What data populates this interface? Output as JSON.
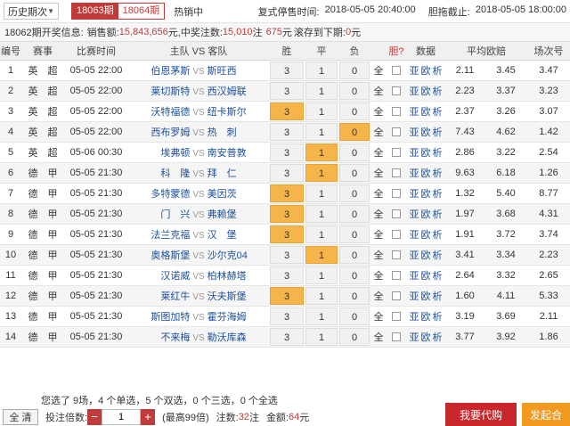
{
  "topbar": {
    "history_label": "历史期次",
    "tab_active": "18063期",
    "tab_inactive": "18064期",
    "sale_status": "热销中",
    "stop_time_label": "复式停售时间:",
    "stop_time": "2018-05-05 20:40:00",
    "deadline_label": "胆拖截止:",
    "deadline": "2018-05-05 18:00:00"
  },
  "infobar": {
    "prefix": "18062期开奖信息:",
    "sales_label": "销售额:",
    "sales": "15,843,656",
    "sales_unit": "元,",
    "prize_label": "中奖注数:",
    "prize_count": "15,010",
    "prize_unit": "注",
    "prize_amount": "675",
    "prize_amount_unit": "元",
    "rollover_label": "滚存到下期:",
    "rollover": "0",
    "rollover_unit": "元"
  },
  "headers": [
    "编号",
    "赛事",
    "比赛时间",
    "主队 VS 客队",
    "胜",
    "平",
    "负",
    "",
    "胆?",
    "数据",
    "平均欧赔",
    "场次号"
  ],
  "vs": "VS",
  "all_label": "全",
  "links": [
    "亚",
    "欧",
    "析"
  ],
  "rows": [
    {
      "no": "1",
      "league": "英　超",
      "time": "05-05 22:00",
      "home": "伯恩茅斯",
      "away": "斯旺西",
      "odds": [
        "3",
        "1",
        "0"
      ],
      "sel": [
        false,
        false,
        false
      ],
      "avg": [
        "2.11",
        "3.45",
        "3.47"
      ]
    },
    {
      "no": "2",
      "league": "英　超",
      "time": "05-05 22:00",
      "home": "莱切斯特",
      "away": "西汉姆联",
      "odds": [
        "3",
        "1",
        "0"
      ],
      "sel": [
        false,
        false,
        false
      ],
      "avg": [
        "2.23",
        "3.37",
        "3.23"
      ]
    },
    {
      "no": "3",
      "league": "英　超",
      "time": "05-05 22:00",
      "home": "沃特福德",
      "away": "纽卡斯尔",
      "odds": [
        "3",
        "1",
        "0"
      ],
      "sel": [
        true,
        false,
        false
      ],
      "avg": [
        "2.37",
        "3.26",
        "3.07"
      ]
    },
    {
      "no": "4",
      "league": "英　超",
      "time": "05-05 22:00",
      "home": "西布罗姆",
      "away": "热　刺",
      "odds": [
        "3",
        "1",
        "0"
      ],
      "sel": [
        false,
        false,
        true
      ],
      "avg": [
        "7.43",
        "4.62",
        "1.42"
      ]
    },
    {
      "no": "5",
      "league": "英　超",
      "time": "05-06 00:30",
      "home": "埃弗顿",
      "away": "南安普敦",
      "odds": [
        "3",
        "1",
        "0"
      ],
      "sel": [
        false,
        true,
        false
      ],
      "avg": [
        "2.86",
        "3.22",
        "2.54"
      ]
    },
    {
      "no": "6",
      "league": "德　甲",
      "time": "05-05 21:30",
      "home": "科　隆",
      "away": "拜　仁",
      "odds": [
        "3",
        "1",
        "0"
      ],
      "sel": [
        false,
        true,
        false
      ],
      "avg": [
        "9.63",
        "6.18",
        "1.26"
      ]
    },
    {
      "no": "7",
      "league": "德　甲",
      "time": "05-05 21:30",
      "home": "多特蒙德",
      "away": "美因茨",
      "odds": [
        "3",
        "1",
        "0"
      ],
      "sel": [
        true,
        false,
        false
      ],
      "avg": [
        "1.32",
        "5.40",
        "8.77"
      ]
    },
    {
      "no": "8",
      "league": "德　甲",
      "time": "05-05 21:30",
      "home": "门　兴",
      "away": "弗赖堡",
      "odds": [
        "3",
        "1",
        "0"
      ],
      "sel": [
        true,
        false,
        false
      ],
      "avg": [
        "1.97",
        "3.68",
        "4.31"
      ]
    },
    {
      "no": "9",
      "league": "德　甲",
      "time": "05-05 21:30",
      "home": "法兰克福",
      "away": "汉　堡",
      "odds": [
        "3",
        "1",
        "0"
      ],
      "sel": [
        true,
        false,
        false
      ],
      "avg": [
        "1.91",
        "3.72",
        "3.74"
      ]
    },
    {
      "no": "10",
      "league": "德　甲",
      "time": "05-05 21:30",
      "home": "奥格斯堡",
      "away": "沙尔克04",
      "odds": [
        "3",
        "1",
        "0"
      ],
      "sel": [
        false,
        true,
        false
      ],
      "avg": [
        "3.41",
        "3.34",
        "2.23"
      ]
    },
    {
      "no": "11",
      "league": "德　甲",
      "time": "05-05 21:30",
      "home": "汉诺威",
      "away": "柏林赫塔",
      "odds": [
        "3",
        "1",
        "0"
      ],
      "sel": [
        false,
        false,
        false
      ],
      "avg": [
        "2.64",
        "3.32",
        "2.65"
      ]
    },
    {
      "no": "12",
      "league": "德　甲",
      "time": "05-05 21:30",
      "home": "莱红牛",
      "away": "沃夫斯堡",
      "odds": [
        "3",
        "1",
        "0"
      ],
      "sel": [
        true,
        false,
        false
      ],
      "avg": [
        "1.60",
        "4.11",
        "5.33"
      ]
    },
    {
      "no": "13",
      "league": "德　甲",
      "time": "05-05 21:30",
      "home": "斯图加特",
      "away": "霍芬海姆",
      "odds": [
        "3",
        "1",
        "0"
      ],
      "sel": [
        false,
        false,
        false
      ],
      "avg": [
        "3.19",
        "3.69",
        "2.11"
      ]
    },
    {
      "no": "14",
      "league": "德　甲",
      "time": "05-05 21:30",
      "home": "不来梅",
      "away": "勒沃库森",
      "odds": [
        "3",
        "1",
        "0"
      ],
      "sel": [
        false,
        false,
        false
      ],
      "avg": [
        "3.77",
        "3.92",
        "1.86"
      ]
    }
  ],
  "summary": "您选了 9场，4 个单选，5 个双选，0 个三选，0 个全选",
  "bottom": {
    "clear_label": "全 清",
    "mult_label": "投注倍数:",
    "minus": "−",
    "mult_value": "1",
    "plus": "+",
    "max_hint": "(最高99倍)",
    "count_label": "注数:",
    "count": "32",
    "count_unit": "注",
    "amount_label": "金额:",
    "amount": "64",
    "amount_unit": "元",
    "buy_label": "我要代购",
    "launch_label": "发起合"
  }
}
